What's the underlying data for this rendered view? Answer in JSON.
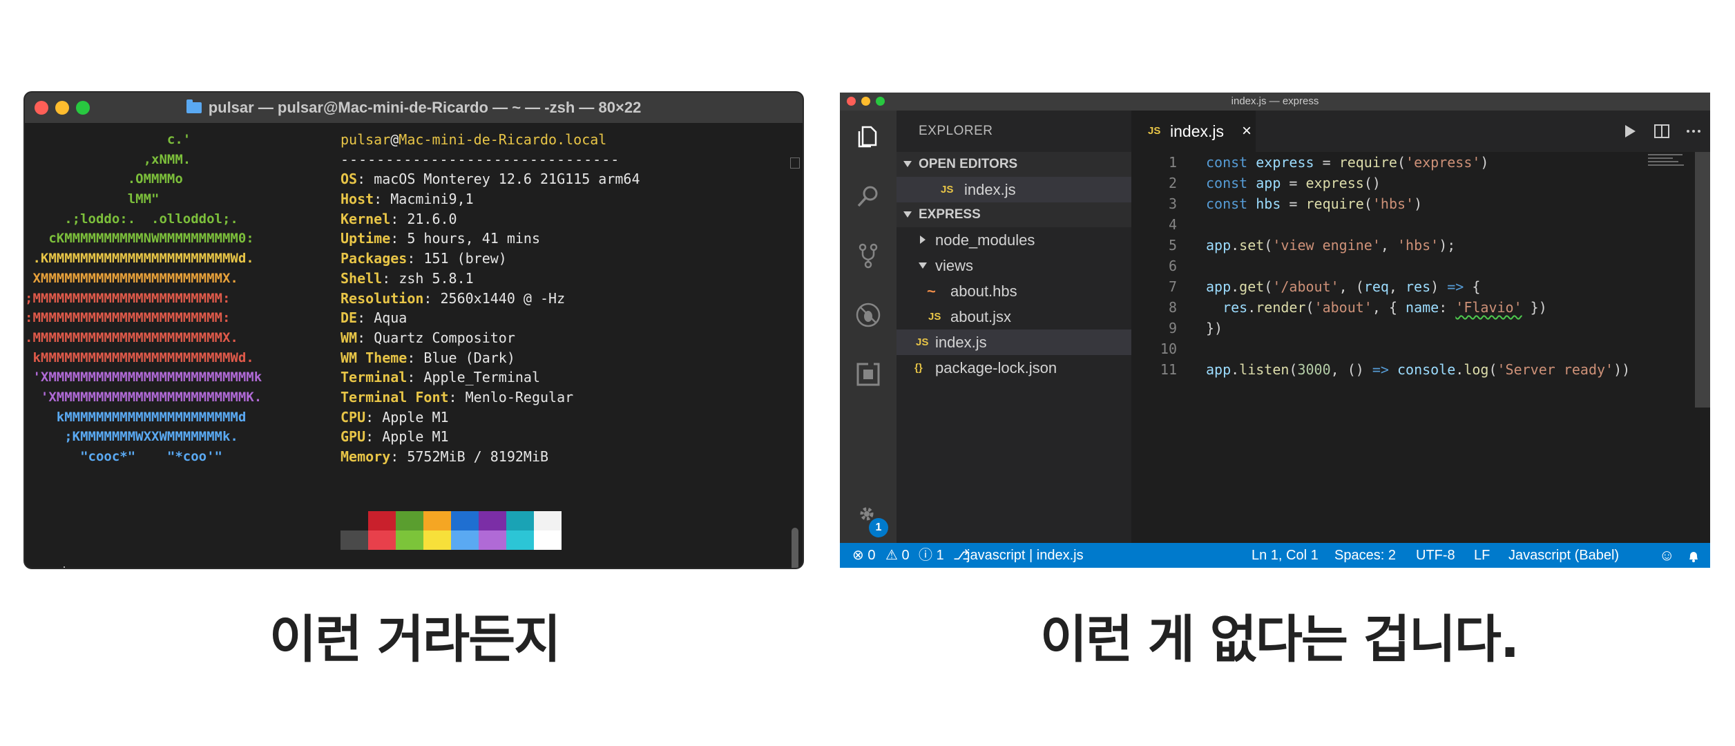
{
  "terminal": {
    "title": "pulsar — pulsar@Mac-mini-de-Ricardo — ~ — -zsh — 80×22",
    "logo_lines": [
      {
        "text": "                  c.'",
        "color": "#7cbf3b"
      },
      {
        "text": "               ,xNMM.",
        "color": "#7cbf3b"
      },
      {
        "text": "             .OMMMMo",
        "color": "#7cbf3b"
      },
      {
        "text": "             lMM\"",
        "color": "#7cbf3b"
      },
      {
        "text": "     .;loddo:.  .olloddol;.",
        "color": "#7cbf3b"
      },
      {
        "text": "   cKMMMMMMMMMMNWMMMMMMMMMM0:",
        "color": "#7cbf3b"
      },
      {
        "text": " .KMMMMMMMMMMMMMMMMMMMMMMMWd.",
        "color": "#e8c547"
      },
      {
        "text": " XMMMMMMMMMMMMMMMMMMMMMMMX.",
        "color": "#e8a13a"
      },
      {
        "text": ";MMMMMMMMMMMMMMMMMMMMMMMM:",
        "color": "#e05a4a"
      },
      {
        "text": ":MMMMMMMMMMMMMMMMMMMMMMMM:",
        "color": "#e05a4a"
      },
      {
        "text": ".MMMMMMMMMMMMMMMMMMMMMMMMX.",
        "color": "#e05a4a"
      },
      {
        "text": " kMMMMMMMMMMMMMMMMMMMMMMMMWd.",
        "color": "#e05a4a"
      },
      {
        "text": " 'XMMMMMMMMMMMMMMMMMMMMMMMMMMk",
        "color": "#b06ad6"
      },
      {
        "text": "  'XMMMMMMMMMMMMMMMMMMMMMMMMK.",
        "color": "#b06ad6"
      },
      {
        "text": "    kMMMMMMMMMMMMMMMMMMMMMMd",
        "color": "#5aa9f2"
      },
      {
        "text": "     ;KMMMMMMMWXXWMMMMMMMk.",
        "color": "#5aa9f2"
      },
      {
        "text": "       \"cooc*\"    \"*coo'\"",
        "color": "#5aa9f2"
      }
    ],
    "user": "pulsar",
    "host": "Mac-mini-de-Ricardo.local",
    "separator": "-------------------------------",
    "info": [
      {
        "key": "OS",
        "value": "macOS Monterey 12.6 21G115 arm64"
      },
      {
        "key": "Host",
        "value": "Macmini9,1"
      },
      {
        "key": "Kernel",
        "value": "21.6.0"
      },
      {
        "key": "Uptime",
        "value": "5 hours, 41 mins"
      },
      {
        "key": "Packages",
        "value": "151 (brew)"
      },
      {
        "key": "Shell",
        "value": "zsh 5.8.1"
      },
      {
        "key": "Resolution",
        "value": "2560x1440 @ -Hz"
      },
      {
        "key": "DE",
        "value": "Aqua"
      },
      {
        "key": "WM",
        "value": "Quartz Compositor"
      },
      {
        "key": "WM Theme",
        "value": "Blue (Dark)"
      },
      {
        "key": "Terminal",
        "value": "Apple_Terminal"
      },
      {
        "key": "Terminal Font",
        "value": "Menlo-Regular"
      },
      {
        "key": "CPU",
        "value": "Apple M1"
      },
      {
        "key": "GPU",
        "value": "Apple M1"
      },
      {
        "key": "Memory",
        "value": "5752MiB / 8192MiB"
      }
    ],
    "swatch_top": [
      "#1e1e1e",
      "#c9202c",
      "#5a9e2f",
      "#f5a623",
      "#1f6fd1",
      "#7b2ea6",
      "#1aa3b5",
      "#f2f2f2"
    ],
    "swatch_bottom": [
      "#4a4a4a",
      "#e8404b",
      "#7cc43a",
      "#f7e03a",
      "#5aa9f2",
      "#b06ad6",
      "#2cc5d6",
      "#ffffff"
    ],
    "prompt": "→  ~"
  },
  "vscode": {
    "title": "index.js — express",
    "explorer_label": "EXPLORER",
    "open_editors_label": "OPEN EDITORS",
    "open_editor_file": "index.js",
    "project_label": "EXPRESS",
    "tree": [
      {
        "name": "node_modules",
        "type": "folder-collapsed"
      },
      {
        "name": "views",
        "type": "folder-open"
      },
      {
        "name": "about.hbs",
        "type": "hbs"
      },
      {
        "name": "about.jsx",
        "type": "js"
      },
      {
        "name": "index.js",
        "type": "js"
      },
      {
        "name": "package-lock.json",
        "type": "json"
      }
    ],
    "tab_label": "index.js",
    "js_badge": "JS",
    "json_badge": "{}",
    "hbs_badge": "~",
    "tab_close": "×",
    "settings_badge": "1",
    "code_lines": [
      "1",
      "2",
      "3",
      "4",
      "5",
      "6",
      "7",
      "8",
      "9",
      "10",
      "11"
    ],
    "status": {
      "errors": "⊗ 0",
      "warnings": "⚠ 0",
      "info": "ⓘ 1",
      "branch": "javascript | index.js",
      "position": "Ln 1, Col 1",
      "spaces": "Spaces: 2",
      "encoding": "UTF-8",
      "eol": "LF",
      "language": "Javascript (Babel)"
    }
  },
  "captions": {
    "left": "이런 거라든지",
    "right": "이런 게 없다는 겁니다."
  },
  "colors": {
    "statusbar": "#007acc",
    "activity_bar": "#333333",
    "sidebar": "#252526",
    "editor": "#1e1e1e",
    "terminal_key": "#e8c547"
  }
}
